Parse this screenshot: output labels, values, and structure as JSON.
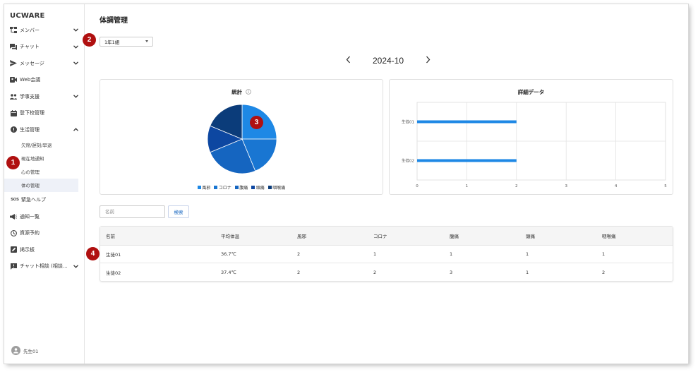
{
  "app": {
    "logo": "UCWARE",
    "user_name": "先生01"
  },
  "sidebar": {
    "items": [
      {
        "label": "メンバー",
        "icon": "org-chart-icon",
        "chevron": "down"
      },
      {
        "label": "チャット",
        "icon": "chat-icon",
        "chevron": "down"
      },
      {
        "label": "メッセージ",
        "icon": "send-icon",
        "chevron": "down"
      },
      {
        "label": "Web会議",
        "icon": "video-icon",
        "chevron": ""
      },
      {
        "label": "学事支援",
        "icon": "people-icon",
        "chevron": "down"
      },
      {
        "label": "登下校管理",
        "icon": "calendar-icon",
        "chevron": ""
      },
      {
        "label": "生活管理",
        "icon": "alert-circle-icon",
        "chevron": "up"
      }
    ],
    "sub_items": [
      "欠席/遅刻/早退",
      "現在地通知",
      "心の管理",
      "体の管理"
    ],
    "items_after": [
      {
        "label": "緊急ヘルプ",
        "icon": "sos-icon",
        "chevron": ""
      },
      {
        "label": "通知一覧",
        "icon": "megaphone-icon",
        "chevron": ""
      },
      {
        "label": "資源予約",
        "icon": "clock-icon",
        "chevron": ""
      },
      {
        "label": "掲示板",
        "icon": "edit-icon",
        "chevron": ""
      },
      {
        "label": "チャット相談 (相談...",
        "icon": "chat-alert-icon",
        "chevron": "down"
      }
    ]
  },
  "main": {
    "title": "体調管理",
    "class_select": "1年1組",
    "month": "2024-10",
    "stats_title": "統計",
    "detail_title": "詳細データ",
    "search_placeholder": "名前",
    "search_button": "検索"
  },
  "annotations": [
    "1",
    "2",
    "3",
    "4"
  ],
  "chart_data": [
    {
      "type": "pie",
      "title": "統計",
      "categories": [
        "風邪",
        "コロナ",
        "腹痛",
        "頭痛",
        "咽喉痛"
      ],
      "values": [
        4,
        3,
        4,
        2,
        3
      ],
      "colors": [
        "#1e88e5",
        "#1976d2",
        "#1565c0",
        "#0d47a1",
        "#0b3c7a"
      ]
    },
    {
      "type": "bar",
      "orientation": "horizontal",
      "title": "詳細データ",
      "categories": [
        "生徒01",
        "生徒02"
      ],
      "values": [
        2,
        2
      ],
      "xlim": [
        0,
        5
      ],
      "xticks": [
        "0",
        "1",
        "2",
        "3",
        "4",
        "5"
      ],
      "color": "#1e88e5"
    }
  ],
  "table": {
    "headers": [
      "名前",
      "平均体温",
      "風邪",
      "コロナ",
      "腹痛",
      "頭痛",
      "咽喉痛"
    ],
    "rows": [
      [
        "生徒01",
        "36.7℃",
        "2",
        "1",
        "1",
        "1",
        "1"
      ],
      [
        "生徒02",
        "37.4℃",
        "2",
        "2",
        "3",
        "1",
        "2"
      ]
    ]
  }
}
